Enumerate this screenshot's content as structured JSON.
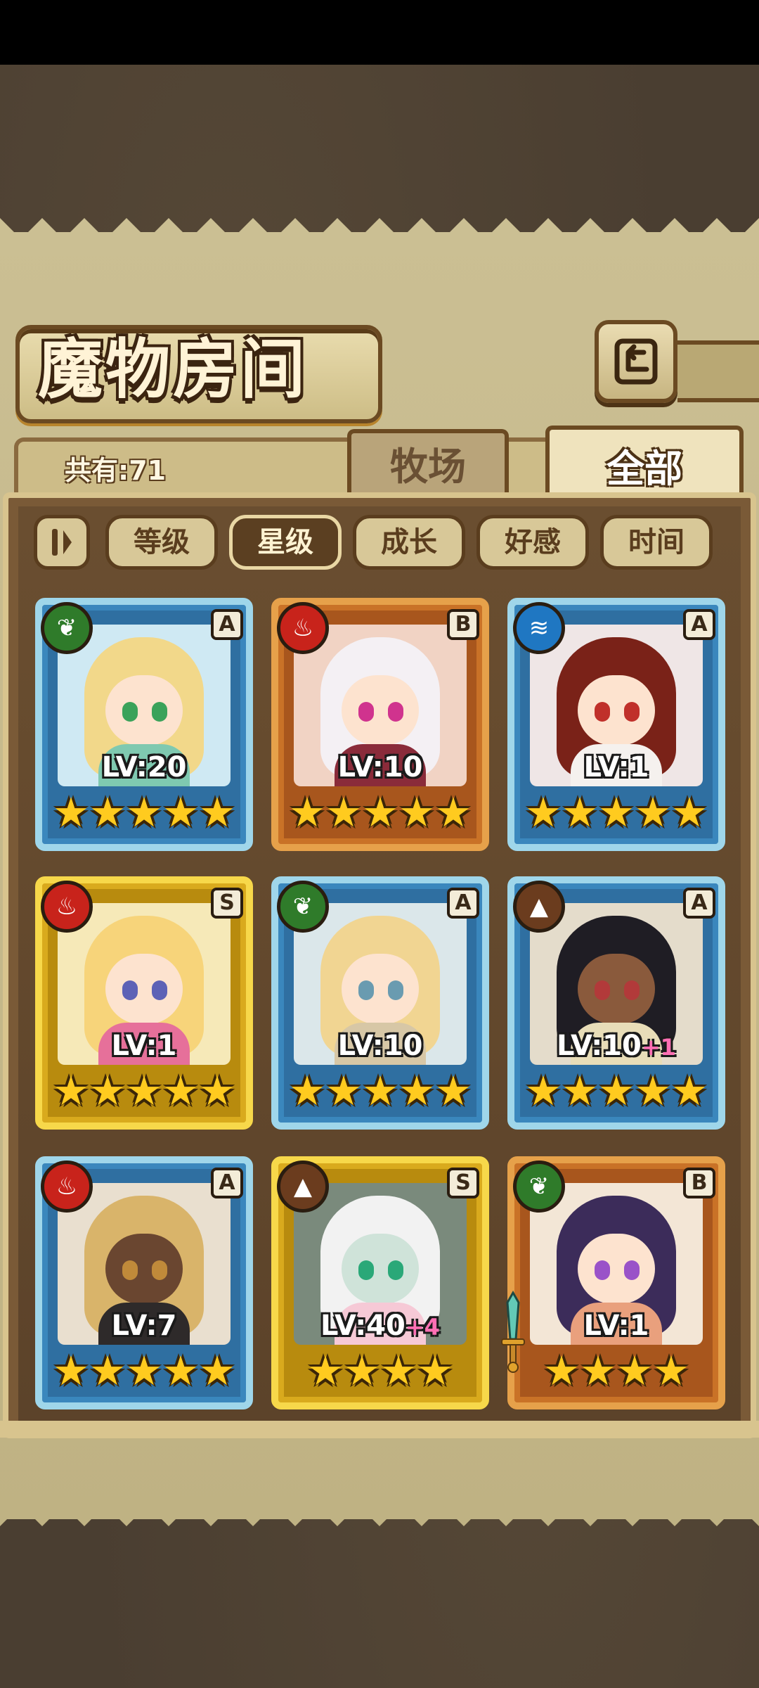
{
  "header": {
    "title": "魔物房间",
    "back_icon": "back-arrow-icon"
  },
  "summary": {
    "count_text": "共有:71"
  },
  "tabs": [
    {
      "label": "牧场",
      "active": false
    },
    {
      "label": "全部",
      "active": true
    }
  ],
  "filters": {
    "sort_icon": "sort-toggle-icon",
    "buttons": [
      {
        "label": "等级",
        "active": false
      },
      {
        "label": "星级",
        "active": true
      },
      {
        "label": "成长",
        "active": false
      },
      {
        "label": "好感",
        "active": false
      },
      {
        "label": "时间",
        "active": false
      }
    ]
  },
  "monsters": [
    {
      "element": "nature",
      "rank": "A",
      "level": "LV:20",
      "bonus": "",
      "stars": "★★★★★",
      "frame": "blue"
    },
    {
      "element": "fire",
      "rank": "B",
      "level": "LV:10",
      "bonus": "",
      "stars": "★★★★★",
      "frame": "orange"
    },
    {
      "element": "water",
      "rank": "A",
      "level": "LV:1",
      "bonus": "",
      "stars": "★★★★★",
      "frame": "blue"
    },
    {
      "element": "fire",
      "rank": "S",
      "level": "LV:1",
      "bonus": "",
      "stars": "★★★★★",
      "frame": "gold"
    },
    {
      "element": "nature",
      "rank": "A",
      "level": "LV:10",
      "bonus": "",
      "stars": "★★★★★",
      "frame": "blue"
    },
    {
      "element": "earth",
      "rank": "A",
      "level": "LV:10",
      "bonus": "+1",
      "stars": "★★★★★",
      "frame": "blue"
    },
    {
      "element": "fire",
      "rank": "A",
      "level": "LV:7",
      "bonus": "",
      "stars": "★★★★★",
      "frame": "blue"
    },
    {
      "element": "earth",
      "rank": "S",
      "level": "LV:40",
      "bonus": "+4",
      "stars": "★★★★",
      "frame": "gold"
    },
    {
      "element": "nature",
      "rank": "B",
      "level": "LV:1",
      "bonus": "",
      "stars": "★★★★",
      "frame": "orange"
    }
  ],
  "colors": {
    "parchment": "#cbbf93",
    "panel": "#5c432a",
    "frame_blue": "#9fd6ea",
    "frame_orange": "#e6a14a",
    "frame_gold": "#f7d84a",
    "star": "#ffcb1f"
  }
}
